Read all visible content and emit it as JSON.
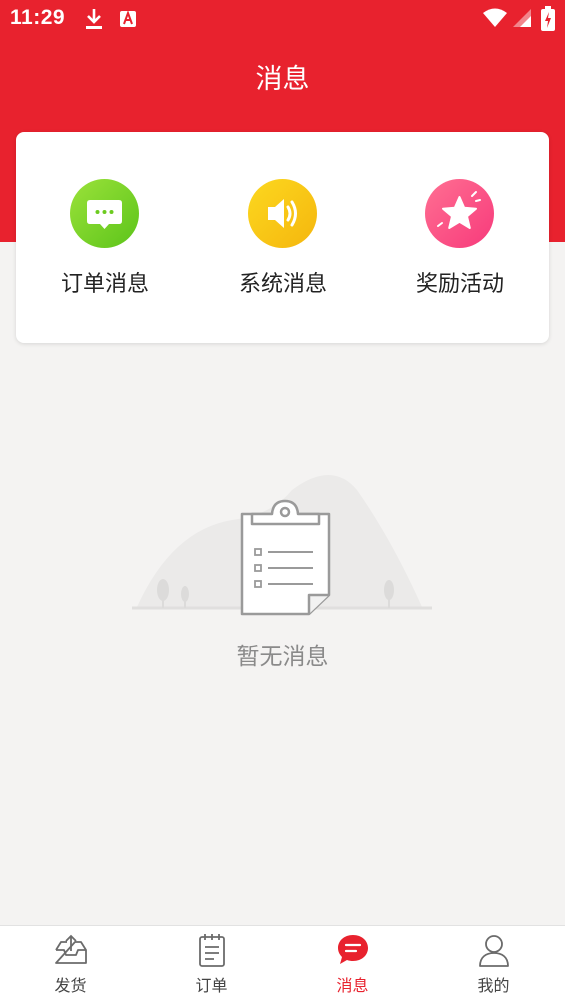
{
  "status_bar": {
    "time": "11:29",
    "icons": [
      "download-icon",
      "app-notification-icon",
      "wifi-icon",
      "signal-icon",
      "battery-icon"
    ]
  },
  "header": {
    "title": "消息",
    "background": "#e8222e"
  },
  "categories": [
    {
      "label": "订单消息",
      "icon": "chat-bubble-icon",
      "color": "#7bd224"
    },
    {
      "label": "系统消息",
      "icon": "speaker-icon",
      "color": "#f9c91a"
    },
    {
      "label": "奖励活动",
      "icon": "star-icon",
      "color": "#ff4f86"
    }
  ],
  "empty_state": {
    "text": "暂无消息",
    "icon": "clipboard-icon"
  },
  "tab_bar": {
    "active": "消息",
    "tabs": [
      {
        "label": "发货",
        "icon": "tray-upload-icon"
      },
      {
        "label": "订单",
        "icon": "notepad-icon"
      },
      {
        "label": "消息",
        "icon": "message-bubble-icon"
      },
      {
        "label": "我的",
        "icon": "person-icon"
      }
    ]
  }
}
